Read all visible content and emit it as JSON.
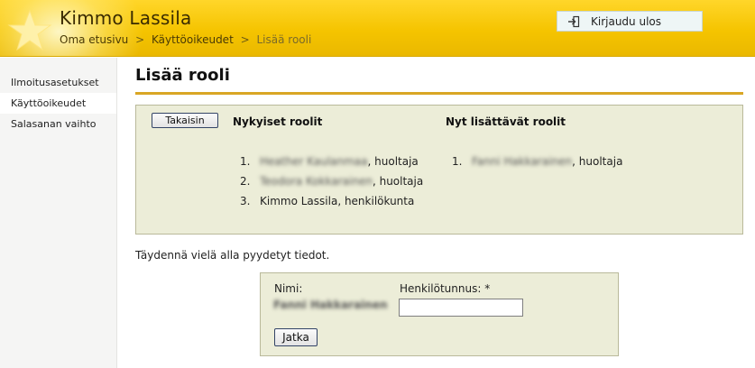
{
  "header": {
    "app_title": "Kimmo Lassila",
    "logout_label": "Kirjaudu ulos",
    "breadcrumb": {
      "home": "Oma etusivu",
      "sep1": ">",
      "permissions": "Käyttöoikeudet",
      "sep2": ">",
      "current": "Lisää rooli"
    },
    "brand_color": "#f5c400"
  },
  "sidebar": {
    "items": [
      {
        "label": "Ilmoitusasetukset"
      },
      {
        "label": "Käyttöoikeudet",
        "active": true
      },
      {
        "label": "Salasanan vaihto"
      }
    ]
  },
  "main": {
    "page_title": "Lisää rooli",
    "back_label": "Takaisin",
    "current_roles_heading": "Nykyiset roolit",
    "new_roles_heading": "Nyt lisättävät roolit",
    "current_roles": [
      {
        "num": "1.",
        "name": "Heather Kaulanmaa",
        "role": ", huoltaja",
        "redacted": true
      },
      {
        "num": "2.",
        "name": "Teodora Kokkarainen",
        "role": ", huoltaja",
        "redacted": true
      },
      {
        "num": "3.",
        "name": "Kimmo Lassila",
        "role": ", henkilökunta",
        "redacted": false
      }
    ],
    "new_roles": [
      {
        "num": "1.",
        "name": "Fanni Hakkarainen",
        "role": ", huoltaja",
        "redacted": true
      }
    ],
    "instruction": "Täydennä vielä alla pyydetyt tiedot.",
    "form": {
      "name_label": "Nimi:",
      "name_value": "Fanni Hakkarainen",
      "ssn_label": "Henkilötunnus: *",
      "ssn_value": "",
      "submit_label": "Jatka"
    }
  }
}
